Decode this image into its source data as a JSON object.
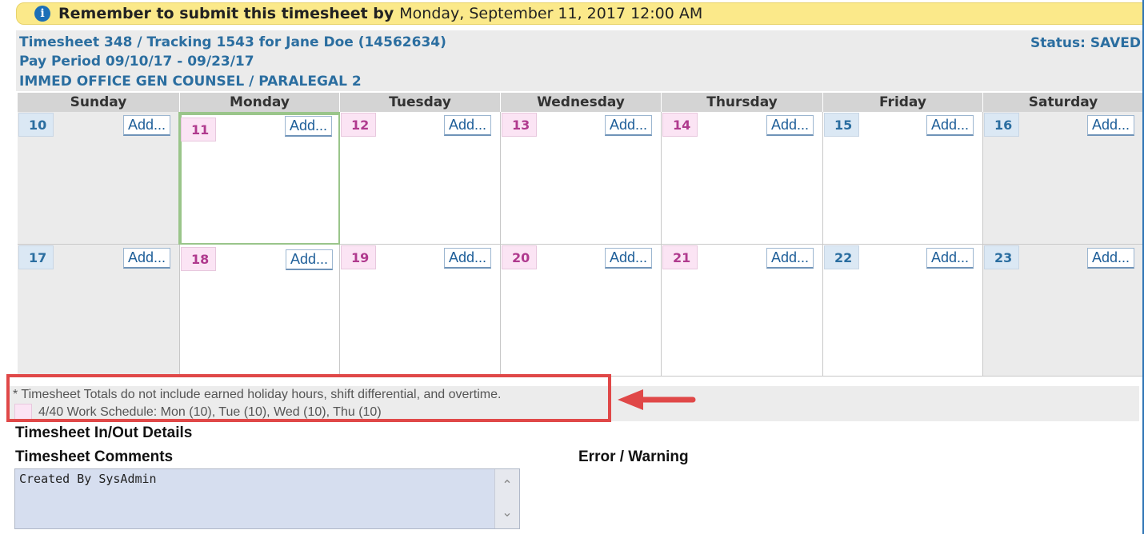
{
  "banner": {
    "lead": "Remember to submit this timesheet by",
    "date": "Monday, September 11, 2017 12:00 AM"
  },
  "header": {
    "title": "Timesheet 348 / Tracking 1543 for Jane Doe (14562634)",
    "pay_period": "Pay Period 09/10/17 - 09/23/17",
    "department": "IMMED OFFICE GEN COUNSEL / PARALEGAL 2",
    "status": "Status: SAVED"
  },
  "calendar": {
    "days": [
      "Sunday",
      "Monday",
      "Tuesday",
      "Wednesday",
      "Thursday",
      "Friday",
      "Saturday"
    ],
    "add_label": "Add...",
    "weeks": [
      [
        "10",
        "11",
        "12",
        "13",
        "14",
        "15",
        "16"
      ],
      [
        "17",
        "18",
        "19",
        "20",
        "21",
        "22",
        "23"
      ]
    ],
    "colors": {
      "scheduled_day": "#fbe4f4",
      "regular_day": "#dbe8f4",
      "today_border": "#9ac58a"
    }
  },
  "legend": {
    "note": "* Timesheet Totals do not include earned holiday hours, shift differential, and overtime.",
    "schedule": "4/40 Work Schedule: Mon (10), Tue (10), Wed (10), Thu (10)"
  },
  "sections": {
    "in_out": "Timesheet In/Out Details",
    "comments": "Timesheet Comments",
    "errors": "Error / Warning"
  },
  "comments_value": "Created By SysAdmin",
  "annotation_color": "#e04848"
}
